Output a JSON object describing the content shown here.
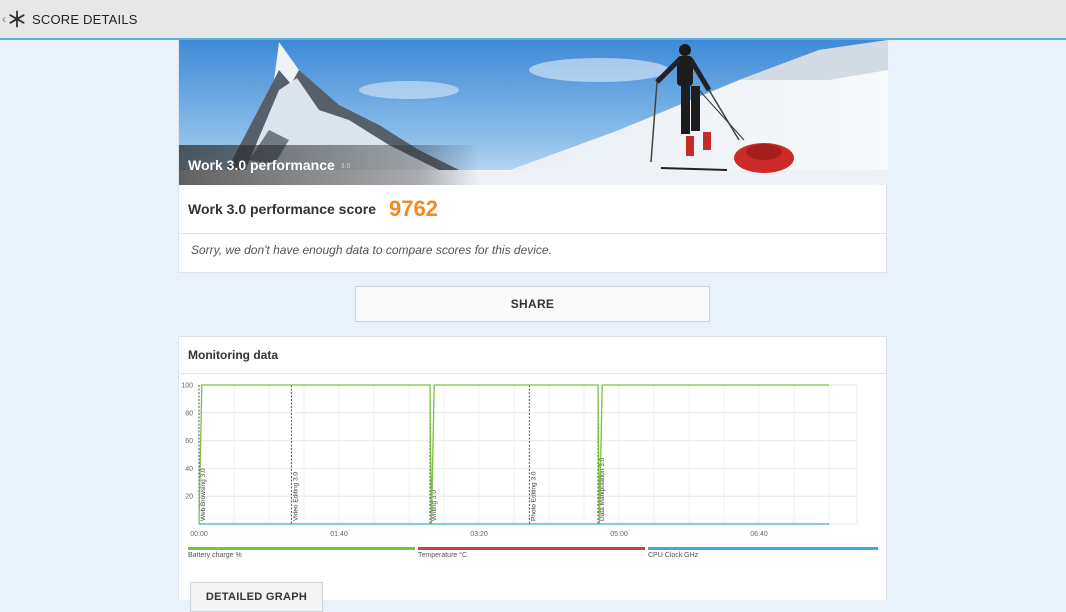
{
  "topbar": {
    "back_glyph": "‹",
    "logo_icon": "snowflake-icon",
    "title": "SCORE DETAILS"
  },
  "hero": {
    "test_name": "Work 3.0 performance",
    "version": "3.0",
    "score_label": "Work 3.0 performance score",
    "score_value": "9762",
    "compare_message": "Sorry, we don't have enough data to compare scores for this device."
  },
  "share_label": "SHARE",
  "monitoring": {
    "title": "Monitoring data",
    "detail_button": "DETAILED GRAPH",
    "legend": [
      {
        "label": "Battery charge %",
        "color": "#7cc043"
      },
      {
        "label": "Temperature °C",
        "color": "#c8414b"
      },
      {
        "label": "CPU Clock GHz",
        "color": "#3fa9dc"
      }
    ]
  },
  "chart_data": {
    "type": "line",
    "x_tick_labels": [
      "00:00",
      "01:40",
      "03:20",
      "05:00",
      "06:40"
    ],
    "y_tick_labels": [
      "20",
      "40",
      "60",
      "80",
      "100"
    ],
    "xlim": [
      0,
      470
    ],
    "ylim": [
      0,
      100
    ],
    "phase_markers": [
      {
        "name": "Web Browsing 3.0",
        "t": 0
      },
      {
        "name": "Video Editing 3.0",
        "t": 66
      },
      {
        "name": "Writing 3.0",
        "t": 165
      },
      {
        "name": "Photo Editing 3.0",
        "t": 236
      },
      {
        "name": "Data Manipulation 3.0",
        "t": 285
      }
    ],
    "series": [
      {
        "name": "Battery charge %",
        "color": "#7cc043",
        "x": [
          0,
          2,
          165,
          166,
          168,
          285,
          286,
          288,
          450
        ],
        "y": [
          0,
          100,
          100,
          0,
          100,
          100,
          0,
          100,
          100
        ]
      },
      {
        "name": "CPU Clock GHz",
        "color": "#3fa9dc",
        "x": [
          0,
          450
        ],
        "y": [
          0,
          0
        ]
      }
    ]
  }
}
